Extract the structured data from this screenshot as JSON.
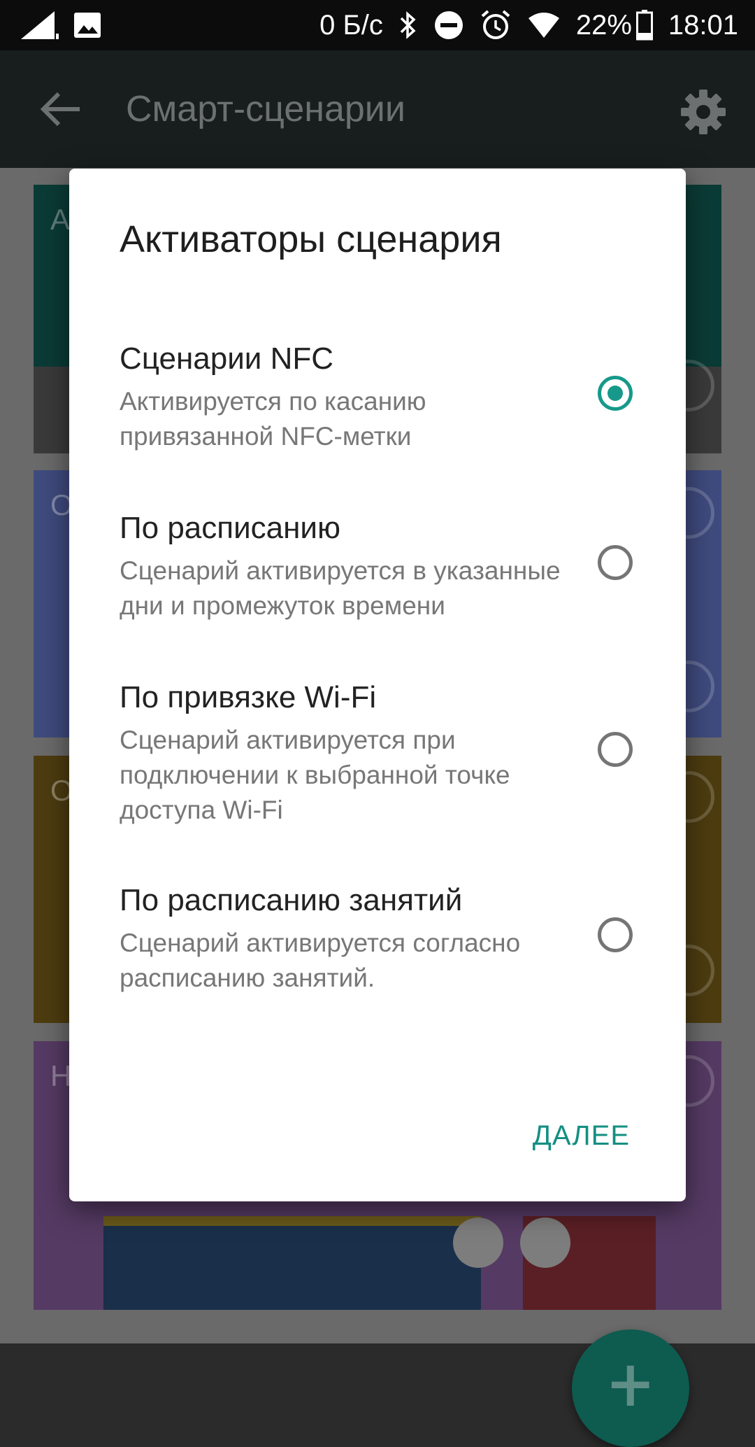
{
  "status_bar": {
    "net_speed": "0 Б/с",
    "battery": "22%",
    "time": "18:01",
    "icons": [
      "signal-icon",
      "image-icon",
      "bluetooth-icon",
      "dnd-icon",
      "alarm-icon",
      "wifi-icon",
      "battery-icon"
    ]
  },
  "toolbar": {
    "title": "Смарт-сценарии"
  },
  "background_cards": [
    {
      "letter": "А",
      "color": "#0b3b36"
    },
    {
      "letter": "О",
      "color": "#3f4b7e"
    },
    {
      "letter": "О",
      "color": "#5b4712"
    },
    {
      "letter": "Н",
      "color": "#553a63"
    }
  ],
  "fab": {
    "label": "+"
  },
  "dialog": {
    "title": "Активаторы сценария",
    "options": [
      {
        "title": "Сценарии NFC",
        "subtitle": "Активируется по касанию привязанной NFC-метки",
        "selected": true
      },
      {
        "title": "По расписанию",
        "subtitle": "Сценарий активируется в указанные дни и промежуток времени",
        "selected": false
      },
      {
        "title": "По привязке Wi-Fi",
        "subtitle": "Сценарий активируется при подключении к выбранной точке доступа Wi-Fi",
        "selected": false
      },
      {
        "title": "По расписанию занятий",
        "subtitle": "Сценарий активируется согласно расписанию занятий.",
        "selected": false
      }
    ],
    "next_label": "ДАЛЕЕ"
  },
  "colors": {
    "accent": "#16998a",
    "dialog_bg": "#ffffff",
    "toolbar_bg": "#181e1e"
  }
}
